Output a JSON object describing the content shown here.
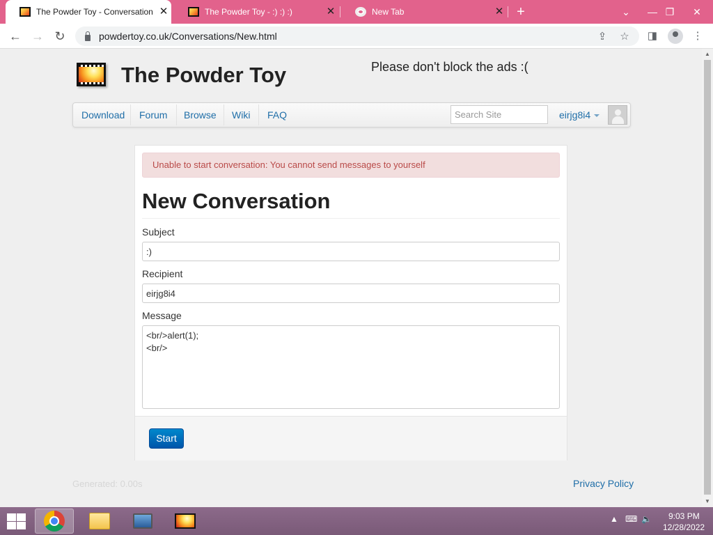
{
  "browser": {
    "tabs": [
      {
        "title": "The Powder Toy - Conversation",
        "active": true
      },
      {
        "title": "The Powder Toy - :) :) :)",
        "active": false
      },
      {
        "title": "New Tab",
        "active": false
      }
    ],
    "url": "powdertoy.co.uk/Conversations/New.html"
  },
  "site": {
    "title": "The Powder Toy",
    "ad_notice": "Please don't block the ads :(",
    "nav": {
      "items": [
        "Download",
        "Forum",
        "Browse",
        "Wiki",
        "FAQ"
      ],
      "search_placeholder": "Search Site",
      "username": "eirjg8i4"
    }
  },
  "form": {
    "error": "Unable to start conversation: You cannot send messages to yourself",
    "heading": "New Conversation",
    "subject_label": "Subject",
    "subject_value": ":)",
    "recipient_label": "Recipient",
    "recipient_value": "eirjg8i4",
    "message_label": "Message",
    "message_value": "<br/>alert(1);\n<br/>",
    "submit_label": "Start"
  },
  "footer": {
    "generated": "Generated: 0.00s",
    "privacy": "Privacy Policy"
  },
  "taskbar": {
    "time": "9:03 PM",
    "date": "12/28/2022"
  },
  "colors": {
    "tab_strip": "#e2628c",
    "link": "#1f6ea8",
    "alert_bg": "#f2dede",
    "alert_text": "#b94a48",
    "primary_button": "#0077c0"
  }
}
